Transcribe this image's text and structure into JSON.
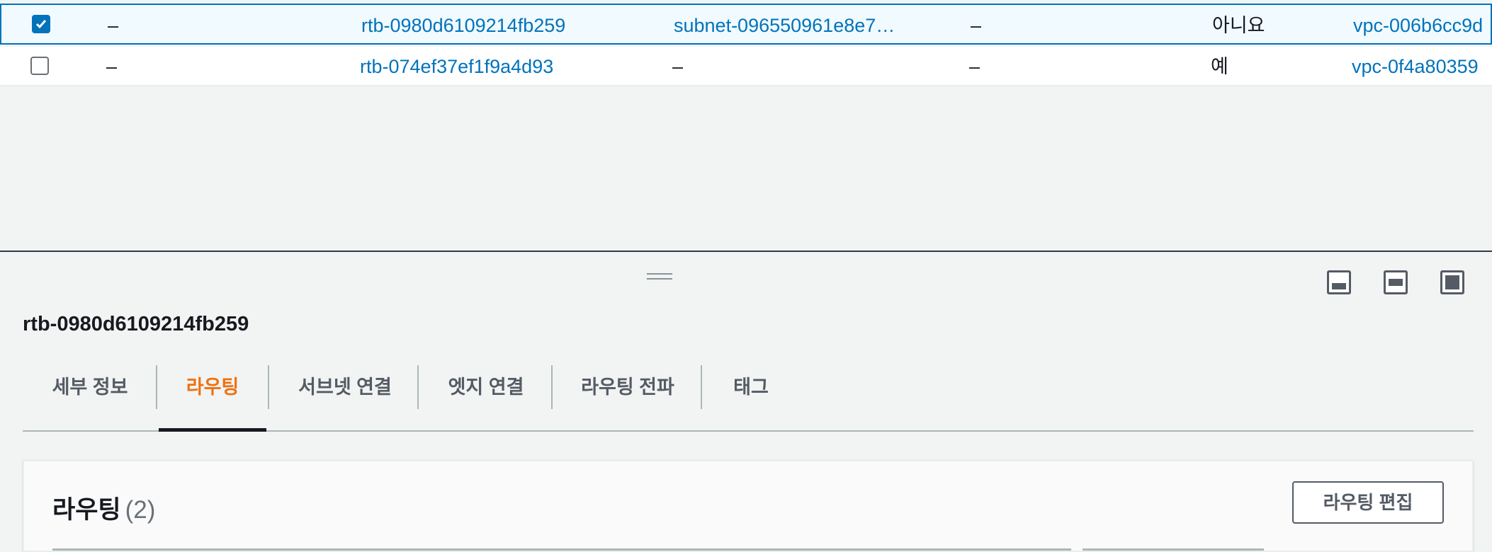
{
  "table": {
    "rows": [
      {
        "checked": true,
        "name": "–",
        "route_table_id": "rtb-0980d6109214fb259",
        "explicit_subnet": "subnet-096550961e8e7…",
        "edge_assoc": "–",
        "main": "아니요",
        "vpc": "vpc-006b6cc9d"
      },
      {
        "checked": false,
        "name": "–",
        "route_table_id": "rtb-074ef37ef1f9a4d93",
        "explicit_subnet": "–",
        "edge_assoc": "–",
        "main": "예",
        "vpc": "vpc-0f4a80359"
      }
    ]
  },
  "split_panel": {
    "title": "rtb-0980d6109214fb259",
    "preference_icons": [
      "panel-bottom-icon",
      "panel-middle-icon",
      "panel-full-icon"
    ],
    "tabs": [
      {
        "label": "세부 정보",
        "active": false
      },
      {
        "label": "라우팅",
        "active": true
      },
      {
        "label": "서브넷 연결",
        "active": false
      },
      {
        "label": "엣지 연결",
        "active": false
      },
      {
        "label": "라우팅 전파",
        "active": false
      },
      {
        "label": "태그",
        "active": false
      }
    ],
    "routes": {
      "title": "라우팅",
      "count": "(2)",
      "edit_button": "라우팅 편집"
    }
  },
  "colors": {
    "link": "#0073bb",
    "active_tab": "#ec7211",
    "selected_row_bg": "#f1faff"
  }
}
